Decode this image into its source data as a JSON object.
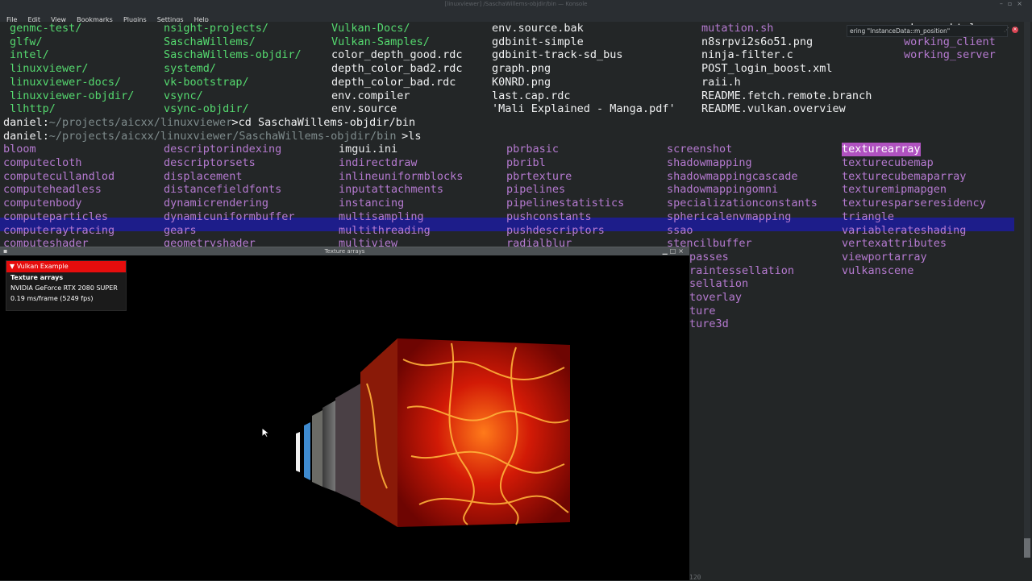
{
  "window": {
    "title": "[linuxviewer] /SaschaWillems-objdir/bin — Konsole"
  },
  "menu": [
    "File",
    "Edit",
    "View",
    "Bookmarks",
    "Plugins",
    "Settings",
    "Help"
  ],
  "tooltip": {
    "text": "ering \"InstanceData::m_position\""
  },
  "terminal": {
    "listing_rows": [
      [
        "genmc-test/",
        "nsight-projects/",
        "Vulkan-Docs/",
        "env.source.bak",
        "mutation.sh",
        "vkspec.html"
      ],
      [
        "glfw/",
        "SaschaWillems/",
        "Vulkan-Samples/",
        "gdbinit-simple",
        "n8srpvi2s6o51.png",
        "working_client"
      ],
      [
        "intel/",
        "SaschaWillems-objdir/",
        "color_depth_good.rdc",
        "gdbinit-track-sd_bus",
        "ninja-filter.c",
        "working_server"
      ],
      [
        "linuxviewer/",
        "systemd/",
        "depth_color_bad2.rdc",
        "graph.png",
        "POST_login_boost.xml",
        ""
      ],
      [
        "linuxviewer-docs/",
        "vk-bootstrap/",
        "depth_color_bad.rdc",
        "K0NRD.png",
        "raii.h",
        ""
      ],
      [
        "linuxviewer-objdir/",
        "vsync/",
        "env.compiler",
        "last.cap.rdc",
        "README.fetch.remote.branch",
        ""
      ],
      [
        "llhttp/",
        "vsync-objdir/",
        "env.source",
        "'Mali Explained - Manga.pdf'",
        "README.vulkan.overview",
        ""
      ]
    ],
    "prompt1": {
      "user": "daniel:",
      "path": "~/projects/aicxx/linuxviewer",
      "cmd": ">cd SaschaWillems-objdir/bin"
    },
    "prompt2": {
      "user": "daniel:",
      "path": "~/projects/aicxx/linuxviewer/SaschaWillems-objdir/bin",
      "cmd": ">ls"
    },
    "bin_rows": [
      [
        "bloom",
        "descriptorindexing",
        "imgui.ini",
        "pbrbasic",
        "screenshot",
        "texturearray"
      ],
      [
        "computecloth",
        "descriptorsets",
        "indirectdraw",
        "pbribl",
        "shadowmapping",
        "texturecubemap"
      ],
      [
        "computecullandlod",
        "displacement",
        "inlineuniformblocks",
        "pbrtexture",
        "shadowmappingcascade",
        "texturecubemaparray"
      ],
      [
        "computeheadless",
        "distancefieldfonts",
        "inputattachments",
        "pipelines",
        "shadowmappingomni",
        "texturemipmapgen"
      ],
      [
        "computenbody",
        "dynamicrendering",
        "instancing",
        "pipelinestatistics",
        "specializationconstants",
        "texturesparseresidency"
      ],
      [
        "computeparticles",
        "dynamicuniformbuffer",
        "multisampling",
        "pushconstants",
        "sphericalenvmapping",
        "triangle"
      ],
      [
        "computeraytracing",
        "gears",
        "multithreading",
        "pushdescriptors",
        "ssao",
        "variablerateshading"
      ],
      [
        "computeshader",
        "geometryshader",
        "multiview",
        "radialblur",
        "stencilbuffer",
        "vertexattributes"
      ]
    ],
    "partial_rows": [
      [
        "passes",
        "viewportarray"
      ],
      [
        "raintessellation",
        "vulkanscene"
      ],
      [
        "sellation",
        ""
      ],
      [
        "toverlay",
        ""
      ],
      [
        "ture",
        ""
      ],
      [
        "ture3d",
        ""
      ]
    ],
    "bottom_text": "    120"
  },
  "vulkan_window": {
    "title": "Texture arrays",
    "overlay": {
      "header": "Vulkan Example",
      "sample": "Texture arrays",
      "gpu": "NVIDIA GeForce RTX 2080 SUPER",
      "fps": "0.19 ms/frame (5249 fps)"
    }
  },
  "colors": {
    "dir": "#55d96f",
    "exe": "#b57ad0",
    "file": "#eff0f1",
    "highlight_row": "#1d1d8a",
    "highlight_cell": "#b052c0",
    "overlay_header": "#e50d0d"
  },
  "icons": [
    "collapse-triangle-icon",
    "mouse-cursor-icon",
    "close-icon",
    "maximize-icon",
    "minimize-icon"
  ]
}
